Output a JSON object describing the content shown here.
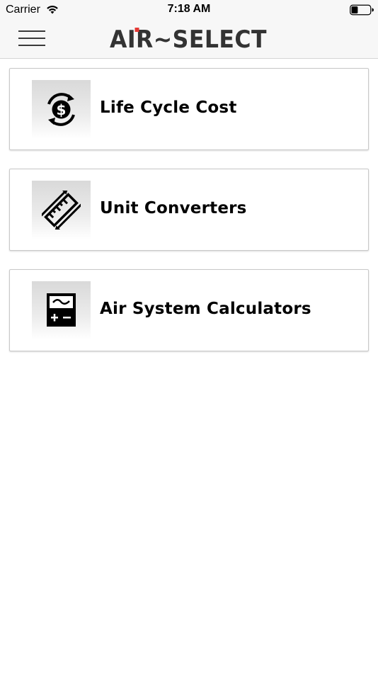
{
  "status_bar": {
    "carrier": "Carrier",
    "time": "7:18 AM",
    "wifi_icon": "wifi-icon",
    "battery_icon": "battery-icon",
    "battery_level": 0.35
  },
  "nav_bar": {
    "menu_icon": "hamburger-menu-icon",
    "logo_text": "AiR~SELECT",
    "logo_accent_color": "#e53935",
    "logo_color": "#333333"
  },
  "menu": {
    "items": [
      {
        "label": "Life Cycle Cost",
        "icon": "dollar-cycle-icon"
      },
      {
        "label": "Unit Converters",
        "icon": "ruler-convert-icon"
      },
      {
        "label": "Air System Calculators",
        "icon": "calculator-icon"
      }
    ]
  }
}
